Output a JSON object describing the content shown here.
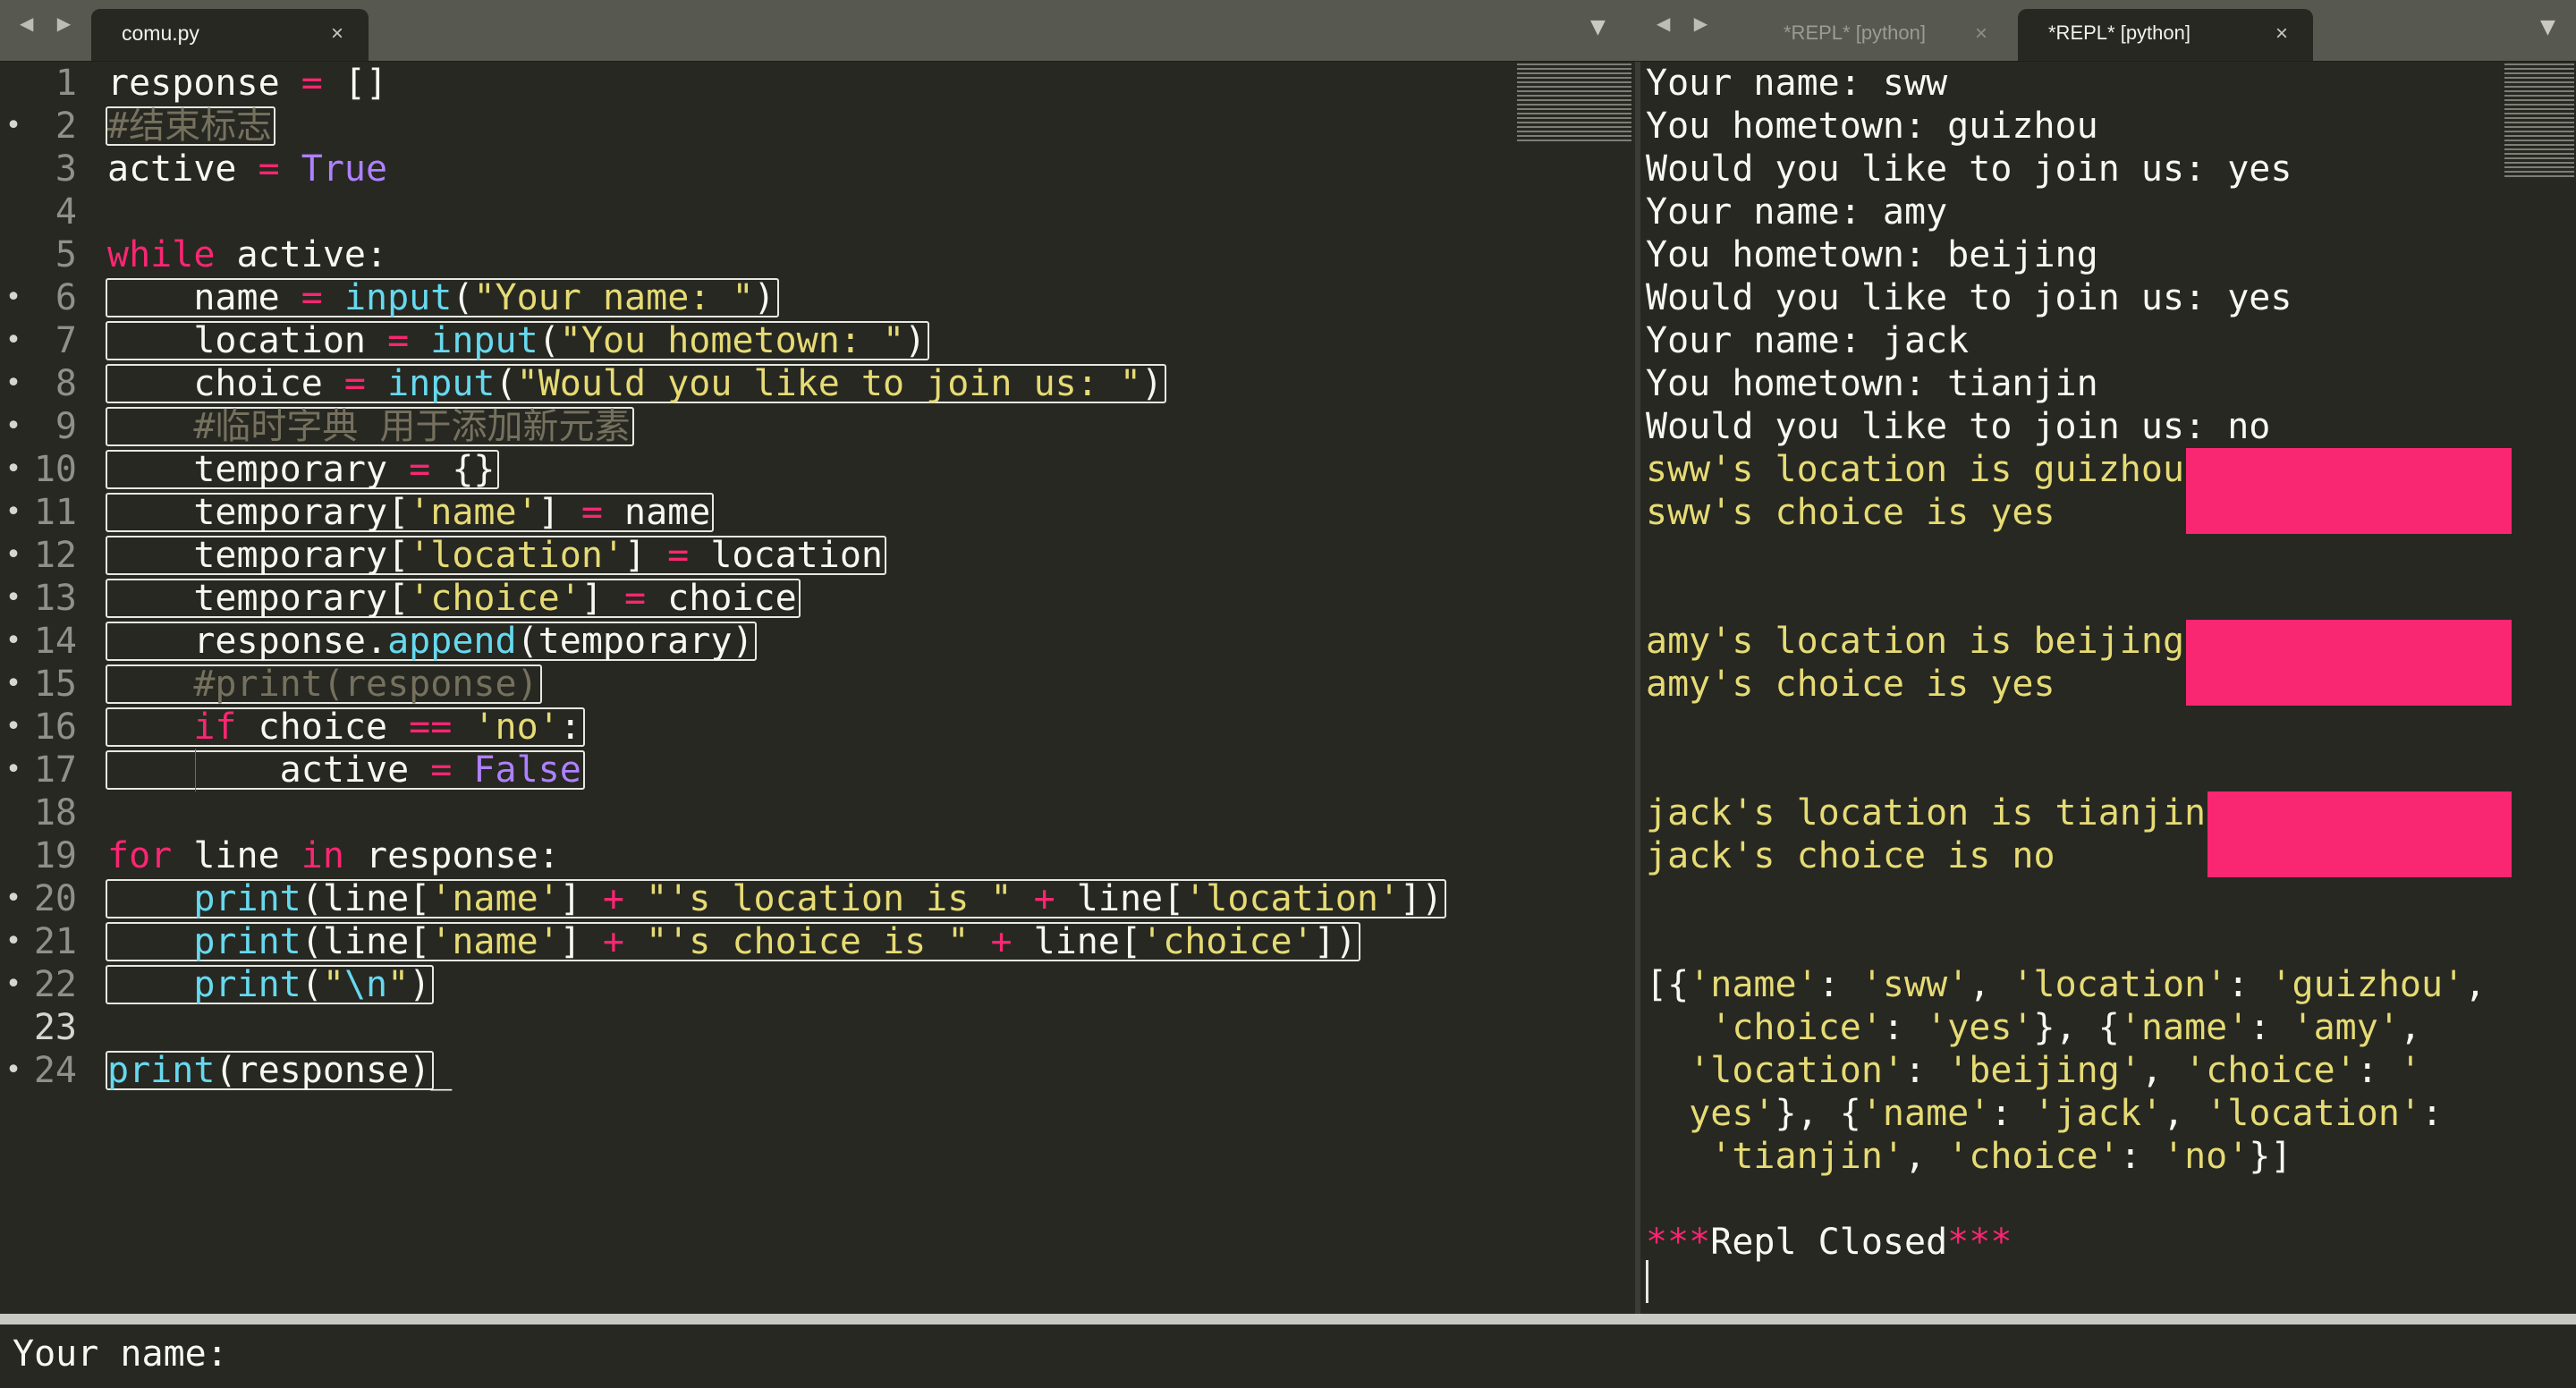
{
  "left_tabs": {
    "active_tab": "comu.py",
    "close_glyph": "×"
  },
  "right_tabs": {
    "tab1": "*REPL* [python]",
    "tab2": "*REPL* [python]",
    "close_glyph": "×"
  },
  "nav_arrows": "◀ ▶",
  "dropdown_glyph": "▼",
  "editor_lines": [
    {
      "num": "1",
      "parts": [
        [
          "t",
          "response "
        ],
        [
          "k",
          "="
        ],
        [
          "t",
          " []"
        ]
      ]
    },
    {
      "num": "2",
      "mod": true,
      "parts": [
        [
          "c",
          "#结束标志"
        ]
      ]
    },
    {
      "num": "3",
      "parts": [
        [
          "t",
          "active "
        ],
        [
          "k",
          "="
        ],
        [
          "t",
          " "
        ],
        [
          "n",
          "True"
        ]
      ]
    },
    {
      "num": "4",
      "parts": []
    },
    {
      "num": "5",
      "parts": [
        [
          "k",
          "while"
        ],
        [
          "t",
          " active:"
        ]
      ]
    },
    {
      "num": "6",
      "mod": true,
      "parts": [
        [
          "t",
          "    name "
        ],
        [
          "k",
          "="
        ],
        [
          "t",
          " "
        ],
        [
          "f",
          "input"
        ],
        [
          "t",
          "("
        ],
        [
          "s",
          "\"Your name: \""
        ],
        [
          "t",
          ")"
        ]
      ]
    },
    {
      "num": "7",
      "mod": true,
      "parts": [
        [
          "t",
          "    location "
        ],
        [
          "k",
          "="
        ],
        [
          "t",
          " "
        ],
        [
          "f",
          "input"
        ],
        [
          "t",
          "("
        ],
        [
          "s",
          "\"You hometown: \""
        ],
        [
          "t",
          ")"
        ]
      ]
    },
    {
      "num": "8",
      "mod": true,
      "parts": [
        [
          "t",
          "    choice "
        ],
        [
          "k",
          "="
        ],
        [
          "t",
          " "
        ],
        [
          "f",
          "input"
        ],
        [
          "t",
          "("
        ],
        [
          "s",
          "\"Would you like to join us: \""
        ],
        [
          "t",
          ")"
        ]
      ]
    },
    {
      "num": "9",
      "mod": true,
      "parts": [
        [
          "t",
          "    "
        ],
        [
          "c",
          "#临时字典 用于添加新元素"
        ]
      ]
    },
    {
      "num": "10",
      "mod": true,
      "parts": [
        [
          "t",
          "    temporary "
        ],
        [
          "k",
          "="
        ],
        [
          "t",
          " {}"
        ]
      ]
    },
    {
      "num": "11",
      "mod": true,
      "parts": [
        [
          "t",
          "    temporary["
        ],
        [
          "s",
          "'name'"
        ],
        [
          "t",
          "] "
        ],
        [
          "k",
          "="
        ],
        [
          "t",
          " name"
        ]
      ]
    },
    {
      "num": "12",
      "mod": true,
      "parts": [
        [
          "t",
          "    temporary["
        ],
        [
          "s",
          "'location'"
        ],
        [
          "t",
          "] "
        ],
        [
          "k",
          "="
        ],
        [
          "t",
          " location"
        ]
      ]
    },
    {
      "num": "13",
      "mod": true,
      "parts": [
        [
          "t",
          "    temporary["
        ],
        [
          "s",
          "'choice'"
        ],
        [
          "t",
          "] "
        ],
        [
          "k",
          "="
        ],
        [
          "t",
          " choice"
        ]
      ]
    },
    {
      "num": "14",
      "mod": true,
      "parts": [
        [
          "t",
          "    response."
        ],
        [
          "f",
          "append"
        ],
        [
          "t",
          "(temporary)"
        ]
      ]
    },
    {
      "num": "15",
      "mod": true,
      "parts": [
        [
          "t",
          "    "
        ],
        [
          "c",
          "#print(response)"
        ]
      ]
    },
    {
      "num": "16",
      "mod": true,
      "parts": [
        [
          "t",
          "    "
        ],
        [
          "k",
          "if"
        ],
        [
          "t",
          " choice "
        ],
        [
          "k",
          "=="
        ],
        [
          "t",
          " "
        ],
        [
          "s",
          "'no'"
        ],
        [
          "t",
          ":"
        ]
      ]
    },
    {
      "num": "17",
      "mod": true,
      "parts": [
        [
          "t",
          "        active "
        ],
        [
          "k",
          "="
        ],
        [
          "t",
          " "
        ],
        [
          "n",
          "False"
        ]
      ]
    },
    {
      "num": "18",
      "parts": []
    },
    {
      "num": "19",
      "parts": [
        [
          "k",
          "for"
        ],
        [
          "t",
          " line "
        ],
        [
          "k",
          "in"
        ],
        [
          "t",
          " response:"
        ]
      ]
    },
    {
      "num": "20",
      "mod": true,
      "parts": [
        [
          "t",
          "    "
        ],
        [
          "f",
          "print"
        ],
        [
          "t",
          "(line["
        ],
        [
          "s",
          "'name'"
        ],
        [
          "t",
          "] "
        ],
        [
          "k",
          "+"
        ],
        [
          "t",
          " "
        ],
        [
          "s",
          "\"'s location is \""
        ],
        [
          "t",
          " "
        ],
        [
          "k",
          "+"
        ],
        [
          "t",
          " line["
        ],
        [
          "s",
          "'location'"
        ],
        [
          "t",
          "])"
        ]
      ]
    },
    {
      "num": "21",
      "mod": true,
      "parts": [
        [
          "t",
          "    "
        ],
        [
          "f",
          "print"
        ],
        [
          "t",
          "(line["
        ],
        [
          "s",
          "'name'"
        ],
        [
          "t",
          "] "
        ],
        [
          "k",
          "+"
        ],
        [
          "t",
          " "
        ],
        [
          "s",
          "\"'s choice is \""
        ],
        [
          "t",
          " "
        ],
        [
          "k",
          "+"
        ],
        [
          "t",
          " line["
        ],
        [
          "s",
          "'choice'"
        ],
        [
          "t",
          "])"
        ]
      ]
    },
    {
      "num": "22",
      "mod": true,
      "parts": [
        [
          "t",
          "    "
        ],
        [
          "f",
          "print"
        ],
        [
          "t",
          "("
        ],
        [
          "s",
          "\""
        ],
        [
          "f",
          "\\n"
        ],
        [
          "s",
          "\""
        ],
        [
          "t",
          ")"
        ]
      ]
    },
    {
      "num": "23",
      "cur": true,
      "parts": []
    },
    {
      "num": "24",
      "mod": true,
      "parts": [
        [
          "f",
          "print"
        ],
        [
          "t",
          "(response)"
        ]
      ]
    }
  ],
  "repl_lines": [
    {
      "text": "Your name: sww"
    },
    {
      "text": "You hometown: guizhou"
    },
    {
      "text": "Would you like to join us: yes"
    },
    {
      "text": "Your name: amy"
    },
    {
      "text": "You hometown: beijing"
    },
    {
      "text": "Would you like to join us: yes"
    },
    {
      "text": "Your name: jack"
    },
    {
      "text": "You hometown: tianjin"
    },
    {
      "text": "Would you like to join us: no"
    },
    {
      "text": "sww's location is guizhou",
      "y": true
    },
    {
      "text": "sww's choice is yes",
      "y": true
    },
    {
      "text": ""
    },
    {
      "text": ""
    },
    {
      "text": "amy's location is beijing",
      "y": true
    },
    {
      "text": "amy's choice is yes",
      "y": true
    },
    {
      "text": ""
    },
    {
      "text": ""
    },
    {
      "text": "jack's location is tianjin",
      "y": true
    },
    {
      "text": "jack's choice is no",
      "y": true
    },
    {
      "text": ""
    },
    {
      "text": ""
    },
    {
      "parts": [
        [
          "t",
          "[{"
        ],
        [
          "s",
          "'name'"
        ],
        [
          "t",
          ": "
        ],
        [
          "s",
          "'sww'"
        ],
        [
          "t",
          ", "
        ],
        [
          "s",
          "'location'"
        ],
        [
          "t",
          ": "
        ],
        [
          "s",
          "'guizhou'"
        ],
        [
          "t",
          ","
        ]
      ]
    },
    {
      "parts": [
        [
          "t",
          "   "
        ],
        [
          "s",
          "'choice'"
        ],
        [
          "t",
          ": "
        ],
        [
          "s",
          "'yes'"
        ],
        [
          "t",
          "}, {"
        ],
        [
          "s",
          "'name'"
        ],
        [
          "t",
          ": "
        ],
        [
          "s",
          "'amy'"
        ],
        [
          "t",
          ","
        ]
      ]
    },
    {
      "parts": [
        [
          "t",
          "  "
        ],
        [
          "s",
          "'location'"
        ],
        [
          "t",
          ": "
        ],
        [
          "s",
          "'beijing'"
        ],
        [
          "t",
          ", "
        ],
        [
          "s",
          "'choice'"
        ],
        [
          "t",
          ": "
        ],
        [
          "s",
          "'"
        ]
      ]
    },
    {
      "parts": [
        [
          "t",
          "  "
        ],
        [
          "s",
          "yes'"
        ],
        [
          "t",
          "}, {"
        ],
        [
          "s",
          "'name'"
        ],
        [
          "t",
          ": "
        ],
        [
          "s",
          "'jack'"
        ],
        [
          "t",
          ", "
        ],
        [
          "s",
          "'location'"
        ],
        [
          "t",
          ":"
        ]
      ]
    },
    {
      "parts": [
        [
          "t",
          "   "
        ],
        [
          "s",
          "'tianjin'"
        ],
        [
          "t",
          ", "
        ],
        [
          "s",
          "'choice'"
        ],
        [
          "t",
          ": "
        ],
        [
          "s",
          "'no'"
        ],
        [
          "t",
          "}]"
        ]
      ]
    },
    {
      "text": ""
    },
    {
      "parts": [
        [
          "k",
          "***"
        ],
        [
          "t",
          "Repl Closed"
        ],
        [
          "k",
          "***"
        ]
      ]
    }
  ],
  "input_prompt": "Your name:"
}
